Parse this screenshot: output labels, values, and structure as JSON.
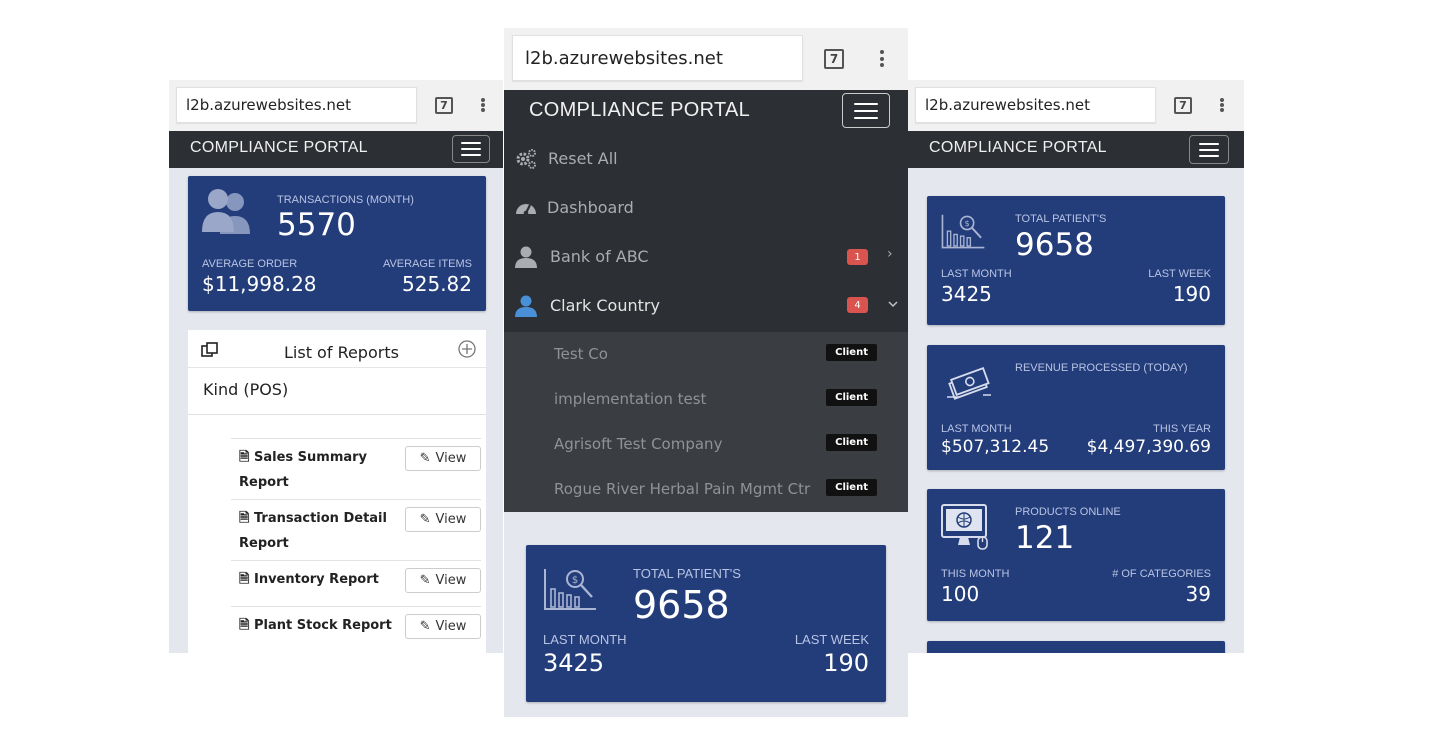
{
  "common": {
    "url": "l2b.azurewebsites.net",
    "tab_count": "7",
    "brand": "COMPLIANCE PORTAL"
  },
  "left": {
    "stat": {
      "title": "TRANSACTIONS (MONTH)",
      "value": "5570",
      "left_label": "AVERAGE ORDER",
      "left_value": "$11,998.28",
      "right_label": "AVERAGE ITEMS",
      "right_value": "525.82"
    },
    "reports_title": "List of Reports",
    "kind": "Kind (POS)",
    "view_label": "View",
    "reports": [
      {
        "name_line1": "Sales Summary",
        "name_line2": "Report"
      },
      {
        "name_line1": "Transaction Detail",
        "name_line2": "Report"
      },
      {
        "name_line1": "Inventory Report",
        "name_line2": ""
      },
      {
        "name_line1": "Plant Stock Report",
        "name_line2": ""
      }
    ]
  },
  "middle": {
    "menu": {
      "reset": "Reset All",
      "dashboard": "Dashboard",
      "bank": "Bank of ABC",
      "bank_badge": "1",
      "clark": "Clark Country",
      "clark_badge": "4"
    },
    "client_label": "Client",
    "clients": [
      "Test Co",
      "implementation test",
      "Agrisoft Test Company",
      "Rogue River Herbal Pain Mgmt Ctr"
    ],
    "stat": {
      "title": "TOTAL PATIENT'S",
      "value": "9658",
      "left_label": "LAST MONTH",
      "left_value": "3425",
      "right_label": "LAST WEEK",
      "right_value": "190"
    }
  },
  "right": {
    "cards": [
      {
        "title": "TOTAL PATIENT'S",
        "value": "9658",
        "left_label": "LAST MONTH",
        "left_value": "3425",
        "right_label": "LAST WEEK",
        "right_value": "190",
        "icon": "chart-search-icon"
      },
      {
        "title": "REVENUE PROCESSED (TODAY)",
        "value": "",
        "left_label": "LAST MONTH",
        "left_value": "$507,312.45",
        "right_label": "THIS YEAR",
        "right_value": "$4,497,390.69",
        "icon": "money-icon"
      },
      {
        "title": "PRODUCTS ONLINE",
        "value": "121",
        "left_label": "THIS MONTH",
        "left_value": "100",
        "right_label": "# OF CATEGORIES",
        "right_value": "39",
        "icon": "monitor-icon"
      }
    ]
  },
  "colors": {
    "card": "#233c7a",
    "navbar": "#2c2f33",
    "badge": "#d9534f"
  }
}
